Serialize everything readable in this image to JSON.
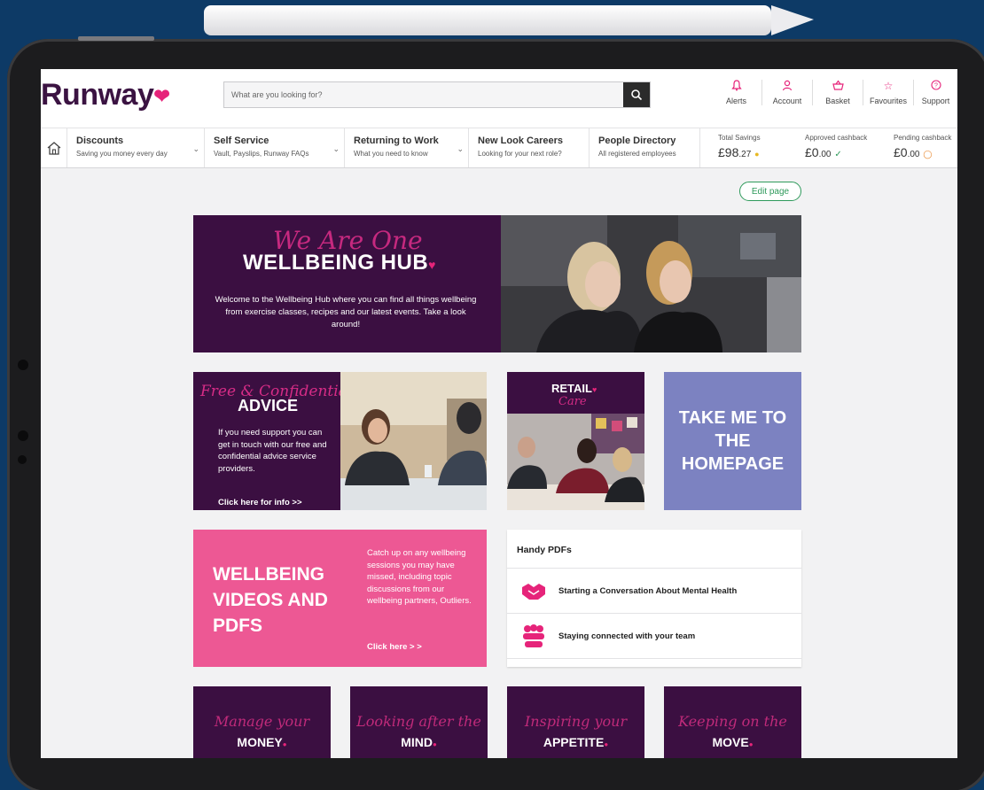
{
  "brand": {
    "name": "Runway",
    "heart_color": "#e6247a",
    "purple": "#3b0f41",
    "pink": "#ed5894",
    "periwinkle": "#7c82c1"
  },
  "search": {
    "placeholder": "What are you looking for?"
  },
  "header_icons": [
    {
      "icon": "bell-icon",
      "label": "Alerts"
    },
    {
      "icon": "user-icon",
      "label": "Account"
    },
    {
      "icon": "basket-icon",
      "label": "Basket"
    },
    {
      "icon": "star-icon",
      "label": "Favourites"
    },
    {
      "icon": "help-icon",
      "label": "Support"
    }
  ],
  "nav": [
    {
      "title": "Discounts",
      "sub": "Saving you money every day"
    },
    {
      "title": "Self Service",
      "sub": "Vault, Payslips, Runway FAQs"
    },
    {
      "title": "Returning to Work",
      "sub": "What you need to know"
    },
    {
      "title": "New Look Careers",
      "sub": "Looking for your next role?"
    },
    {
      "title": "People Directory",
      "sub": "All registered employees"
    }
  ],
  "savings": [
    {
      "label": "Total Savings",
      "main": "£98",
      "cents": ".27"
    },
    {
      "label": "Approved cashback",
      "main": "£0",
      "cents": ".00"
    },
    {
      "label": "Pending cashback",
      "main": "£0",
      "cents": ".00"
    }
  ],
  "edit_page": "Edit page",
  "hero": {
    "script": "We Are One",
    "title": "WELLBEING HUB",
    "desc": "Welcome to the Wellbeing Hub where you can find all things wellbeing from exercise classes, recipes and our latest events. Take a look around!"
  },
  "advice": {
    "script": "Free & Confidential",
    "title": "ADVICE",
    "desc": "If you need support you can get in touch with our free and confidential advice service providers.",
    "cta": "Click here for info >>"
  },
  "retail": {
    "title": "RETAIL",
    "script": "Care"
  },
  "homepage": {
    "title": "TAKE ME TO THE HOMEPAGE"
  },
  "videos": {
    "title": "WELLBEING VIDEOS AND PDFS",
    "desc": "Catch up on any wellbeing sessions you may have missed, including topic discussions from our wellbeing partners, Outliers.",
    "cta": "Click here > >"
  },
  "pdfs": {
    "title": "Handy PDFs",
    "items": [
      {
        "icon": "handshake-icon",
        "label": "Starting a Conversation About Mental Health"
      },
      {
        "icon": "team-icon",
        "label": "Staying connected with your team"
      }
    ]
  },
  "bottom_tiles": [
    {
      "script": "Manage your",
      "title": "MONEY"
    },
    {
      "script": "Looking after the",
      "title": "MIND"
    },
    {
      "script": "Inspiring your",
      "title": "APPETITE"
    },
    {
      "script": "Keeping on the",
      "title": "MOVE"
    }
  ]
}
